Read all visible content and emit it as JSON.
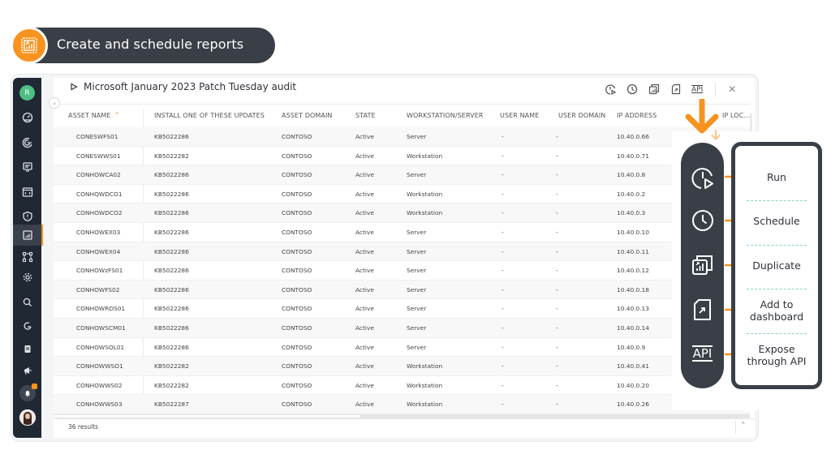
{
  "hero": {
    "title": "Create and schedule  reports",
    "icon": "report-chart-icon",
    "accent_color": "#f7931e",
    "pill_color": "#3a3f47"
  },
  "sidebar": {
    "user_initial": "R",
    "items": [
      {
        "name": "dashboard",
        "icon": "speedometer-icon"
      },
      {
        "name": "scans",
        "icon": "radar-icon"
      },
      {
        "name": "assets",
        "icon": "monitor-icon"
      },
      {
        "name": "software",
        "icon": "code-window-icon"
      },
      {
        "name": "vulnerabilities",
        "icon": "shield-icon"
      },
      {
        "name": "reports",
        "icon": "report-icon",
        "active": true
      },
      {
        "name": "diagrams",
        "icon": "network-icon"
      },
      {
        "name": "settings",
        "icon": "gear-icon"
      },
      {
        "name": "search",
        "icon": "search-icon"
      },
      {
        "name": "refresh",
        "icon": "refresh-icon"
      },
      {
        "name": "clipboard",
        "icon": "clipboard-icon"
      },
      {
        "name": "announcements",
        "icon": "megaphone-icon"
      },
      {
        "name": "notifications",
        "icon": "bell-icon"
      },
      {
        "name": "profile",
        "icon": "user-avatar-icon"
      }
    ]
  },
  "report": {
    "title": "Microsoft January 2023 Patch Tuesday audit",
    "toolbar": {
      "run": "run-icon",
      "schedule": "clock-icon",
      "duplicate": "duplicate-icon",
      "dashboard": "add-dashboard-icon",
      "api_label": "API",
      "close": "✕"
    }
  },
  "table": {
    "columns": [
      "ASSET NAME",
      "INSTALL ONE OF THESE UPDATES",
      "ASSET DOMAIN",
      "STATE",
      "WORKSTATION/SERVER",
      "USER NAME",
      "USER DOMAIN",
      "IP ADDRESS",
      "IP LOC..."
    ],
    "sort_indicator": "^",
    "rows": [
      [
        "CONESWFS01",
        "KB5022286",
        "CONTOSO",
        "Active",
        "Server",
        "-",
        "-",
        "10.40.0.66"
      ],
      [
        "CONESWWS01",
        "KB5022282",
        "CONTOSO",
        "Active",
        "Workstation",
        "-",
        "-",
        "10.40.0.71"
      ],
      [
        "CONHOWCA02",
        "KB5022286",
        "CONTOSO",
        "Active",
        "Server",
        "-",
        "-",
        "10.40.0.8"
      ],
      [
        "CONHQWDCO1",
        "KB5022286",
        "CONTOSO",
        "Active",
        "Workstation",
        "-",
        "-",
        "10.40.0.2"
      ],
      [
        "CONHOWDCO2",
        "KB5022286",
        "CONTOSO",
        "Active",
        "Workstation",
        "-",
        "-",
        "10.40.0.3"
      ],
      [
        "CONHOWEX03",
        "KB5022286",
        "CONTOSO",
        "Active",
        "Server",
        "-",
        "-",
        "10.40.0.10"
      ],
      [
        "CONHQWEX04",
        "KB5022286",
        "CONTOSO",
        "Active",
        "Server",
        "-",
        "-",
        "10.40.0.11"
      ],
      [
        "CONHOWzFS01",
        "KB5022286",
        "CONTOSO",
        "Active",
        "Server",
        "-",
        "-",
        "10.40.0.12"
      ],
      [
        "CONHOWFS02",
        "KB5022286",
        "CONTOSO",
        "Active",
        "Server",
        "-",
        "-",
        "10.40.0.18"
      ],
      [
        "CONHOWRDS01",
        "KB5022286",
        "CONTOSO",
        "Active",
        "Server",
        "-",
        "-",
        "10.40.0.13"
      ],
      [
        "CONHOWSCM01",
        "KB5022286",
        "CONTOSO",
        "Active",
        "Server",
        "-",
        "-",
        "10.40.0.14"
      ],
      [
        "CONHOWSOL01",
        "KB5022286",
        "CONTOSO",
        "Active",
        "Server",
        "-",
        "-",
        "10.40.0.9"
      ],
      [
        "CONHOWWSO1",
        "KB5022282",
        "CONTOSO",
        "Active",
        "Workstation",
        "-",
        "-",
        "10.40.0.41"
      ],
      [
        "CONHOWWS02",
        "KB5022282",
        "CONTOSO",
        "Active",
        "Workstation",
        "-",
        "-",
        "10.40.0.20"
      ],
      [
        "CONHOWWS03",
        "KB5022287",
        "CONTOSO",
        "Active",
        "Workstation",
        "-",
        "-",
        "10.40.0.26"
      ]
    ],
    "last_row_extra": "-",
    "results": "36 results"
  },
  "callout": {
    "actions": [
      {
        "label": "Run",
        "icon": "run-icon"
      },
      {
        "label": "Schedule",
        "icon": "clock-icon"
      },
      {
        "label": "Duplicate",
        "icon": "duplicate-icon"
      },
      {
        "label": "Add to\ndashboard",
        "icon": "add-dashboard-icon"
      },
      {
        "label": "Expose\nthrough API",
        "icon": "api-icon"
      }
    ],
    "api_text": "API"
  }
}
